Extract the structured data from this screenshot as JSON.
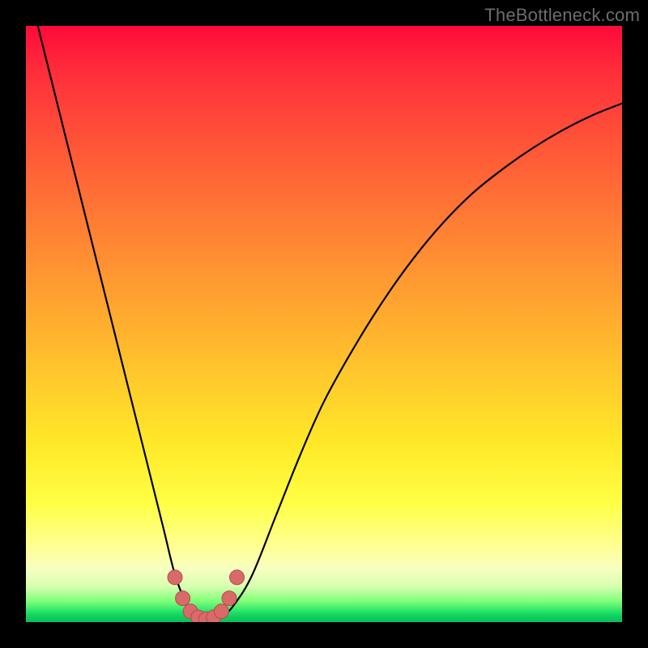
{
  "watermark": "TheBottleneck.com",
  "colors": {
    "frame": "#000000",
    "curve_stroke": "#000000",
    "marker_fill": "#d86a6a",
    "marker_stroke": "#b94a4a",
    "text": "#6d6d6d"
  },
  "chart_data": {
    "type": "line",
    "title": "",
    "xlabel": "",
    "ylabel": "",
    "xlim": [
      0,
      100
    ],
    "ylim": [
      0,
      100
    ],
    "grid": false,
    "legend": false,
    "annotations": [],
    "series": [
      {
        "name": "bottleneck-curve",
        "x": [
          2,
          5,
          8,
          11,
          14,
          17,
          20,
          23,
          25,
          27,
          29,
          31,
          33,
          35,
          38,
          42,
          46,
          50,
          55,
          60,
          65,
          70,
          75,
          80,
          85,
          90,
          95,
          100
        ],
        "y": [
          100,
          88,
          76,
          64,
          52,
          40,
          28,
          16,
          8,
          3,
          1,
          0.5,
          1,
          3,
          8,
          18,
          28,
          37,
          46,
          54,
          61,
          67,
          72,
          76,
          79.5,
          82.5,
          85,
          87
        ]
      },
      {
        "name": "optimal-markers",
        "x": [
          25,
          26.3,
          27.6,
          28.9,
          30.2,
          31.5,
          32.8,
          34.1,
          35.4
        ],
        "y": [
          7.5,
          4.0,
          1.8,
          0.8,
          0.5,
          0.8,
          1.8,
          4.0,
          7.5
        ]
      }
    ]
  }
}
